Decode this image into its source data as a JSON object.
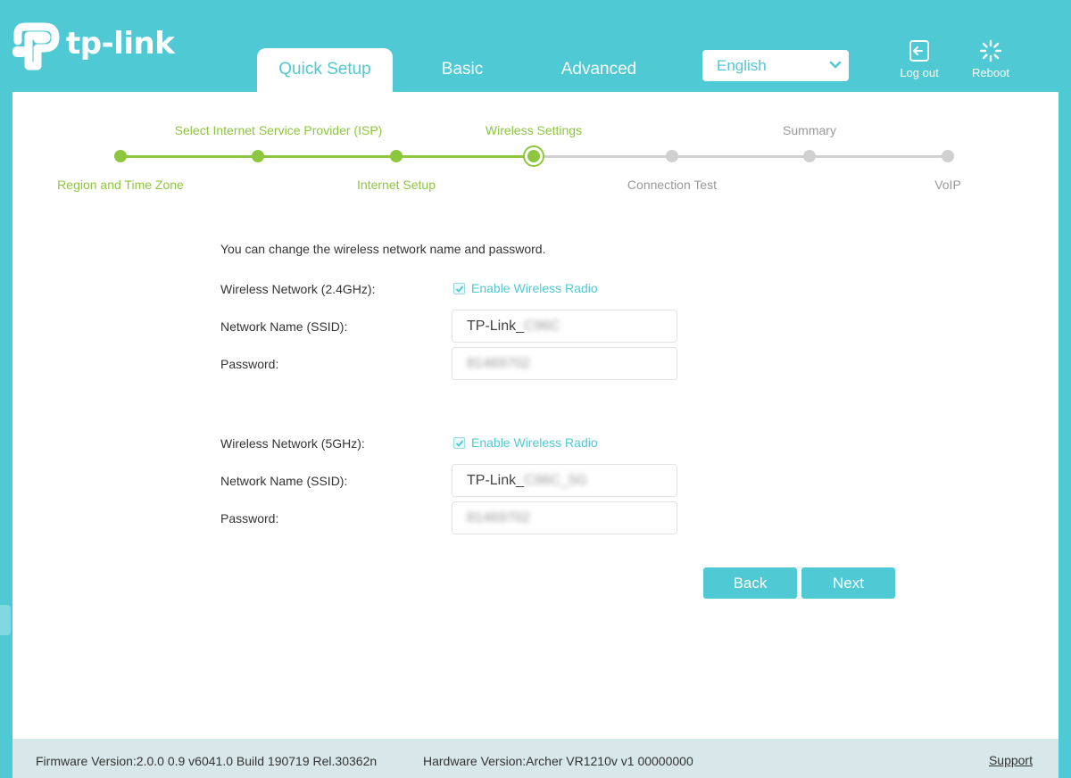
{
  "brand": {
    "logo_text": "tp-link",
    "accent": "#4fc9d4",
    "progress_color": "#8dc63f"
  },
  "tabs": [
    {
      "label": "Quick Setup",
      "active": true
    },
    {
      "label": "Basic",
      "active": false
    },
    {
      "label": "Advanced",
      "active": false
    }
  ],
  "language": {
    "selected": "English"
  },
  "header_actions": {
    "logout": "Log out",
    "reboot": "Reboot"
  },
  "steps": [
    {
      "label": "Region and Time Zone",
      "status": "done"
    },
    {
      "label": "Select Internet Service Provider (ISP)",
      "status": "done"
    },
    {
      "label": "Internet Setup",
      "status": "done"
    },
    {
      "label": "Wireless Settings",
      "status": "current"
    },
    {
      "label": "Connection Test",
      "status": "todo"
    },
    {
      "label": "Summary",
      "status": "todo"
    },
    {
      "label": "VoIP",
      "status": "todo"
    }
  ],
  "form": {
    "intro": "You can change the wireless network name and password.",
    "band_24": {
      "label": "Wireless Network (2.4GHz):",
      "enable_label": "Enable Wireless Radio",
      "enabled": true,
      "ssid_label": "Network Name (SSID):",
      "ssid_prefix": "TP-Link_",
      "ssid_suffix": "C96C",
      "password_label": "Password:",
      "password_value": "81469702"
    },
    "band_5": {
      "label": "Wireless Network (5GHz):",
      "enable_label": "Enable Wireless Radio",
      "enabled": true,
      "ssid_label": "Network Name (SSID):",
      "ssid_prefix": "TP-Link_",
      "ssid_suffix": "C96C_5G",
      "password_label": "Password:",
      "password_value": "81469702"
    },
    "back_label": "Back",
    "next_label": "Next"
  },
  "footer": {
    "firmware": "Firmware Version:2.0.0 0.9 v6041.0 Build 190719 Rel.30362n",
    "hardware": "Hardware Version:Archer VR1210v v1 00000000",
    "support": "Support"
  }
}
